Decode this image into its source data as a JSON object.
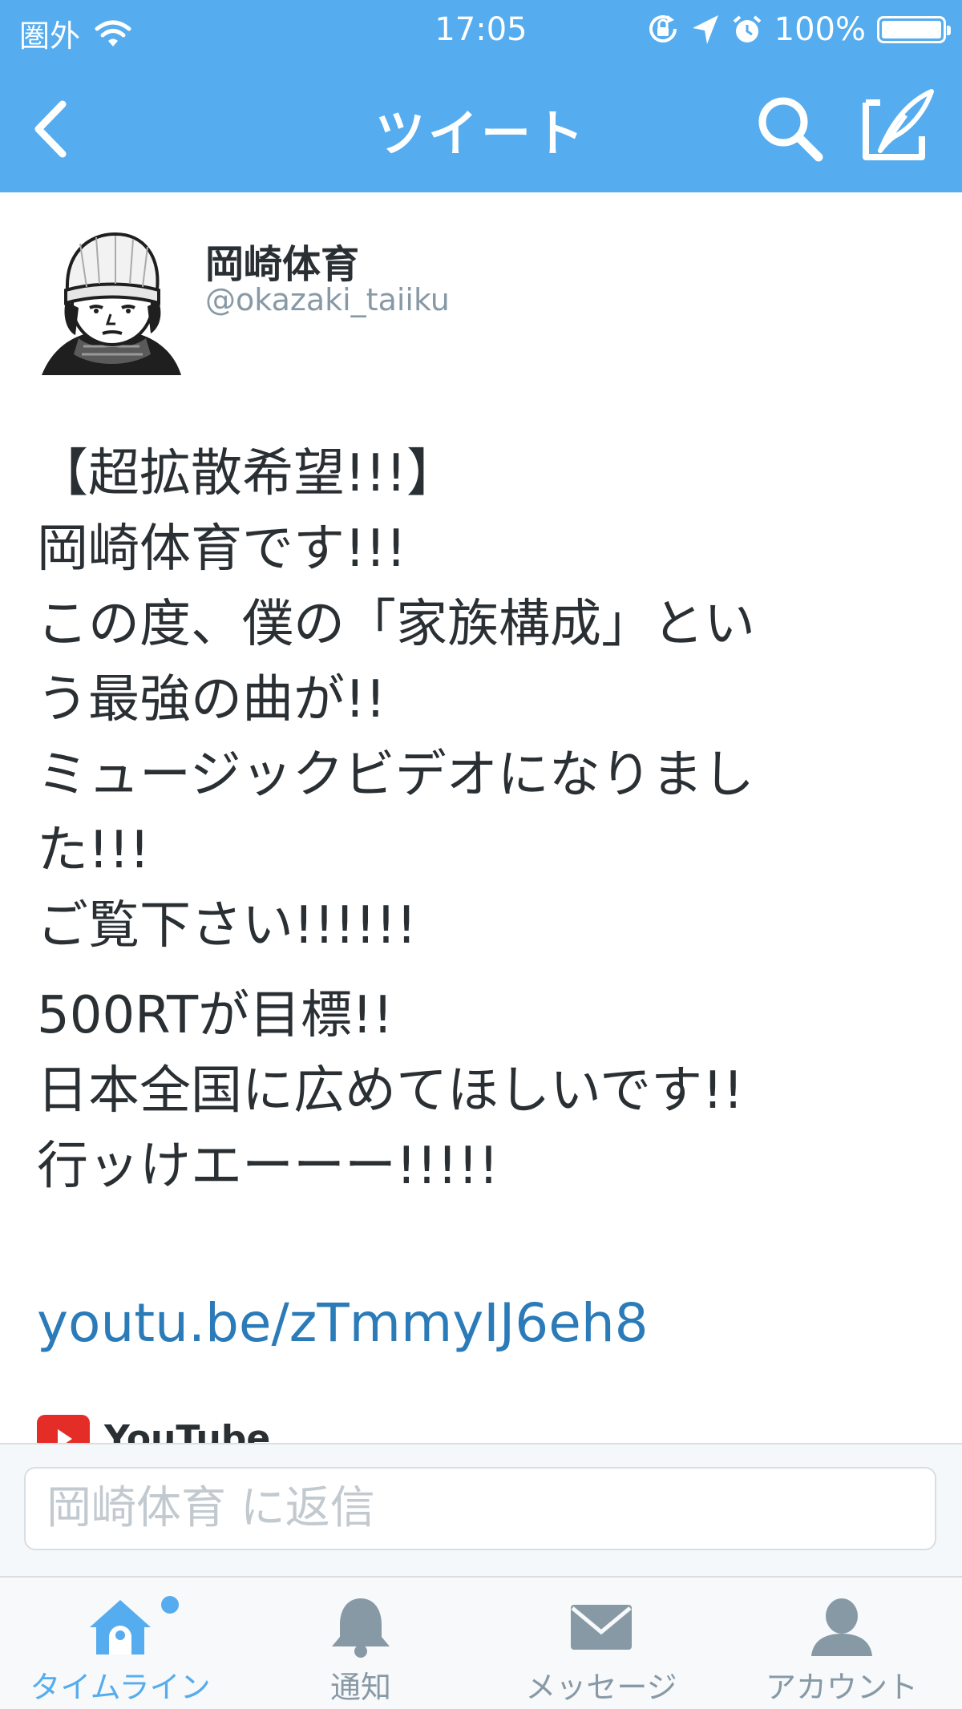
{
  "status_bar": {
    "carrier": "圏外",
    "time": "17:05",
    "battery": "100%"
  },
  "nav": {
    "title": "ツイート"
  },
  "tweet": {
    "user_name": "岡崎体育",
    "user_handle": "@okazaki_taiiku",
    "paragraphs": [
      "【超拡散希望!!!】\n岡崎体育です!!!\nこの度、僕の「家族構成」とい\nう最強の曲が!!\nミュージックビデオになりまし\nた!!!\nご覧下さい!!!!!!",
      "500RTが目標!!\n日本全国に広めてほしいです!!\n行ッけエーーー!!!!!"
    ],
    "link": "youtu.be/zTmmyIJ6eh8",
    "card_label": "YouTube"
  },
  "reply": {
    "placeholder": "岡崎体育 に返信"
  },
  "tabs": [
    {
      "label": "タイムライン",
      "icon": "home-icon",
      "active": true
    },
    {
      "label": "通知",
      "icon": "bell-icon",
      "active": false
    },
    {
      "label": "メッセージ",
      "icon": "envelope-icon",
      "active": false
    },
    {
      "label": "アカウント",
      "icon": "person-icon",
      "active": false
    }
  ],
  "colors": {
    "brand": "#55acee",
    "link": "#2b7bb9",
    "inactive": "#8899a6"
  }
}
